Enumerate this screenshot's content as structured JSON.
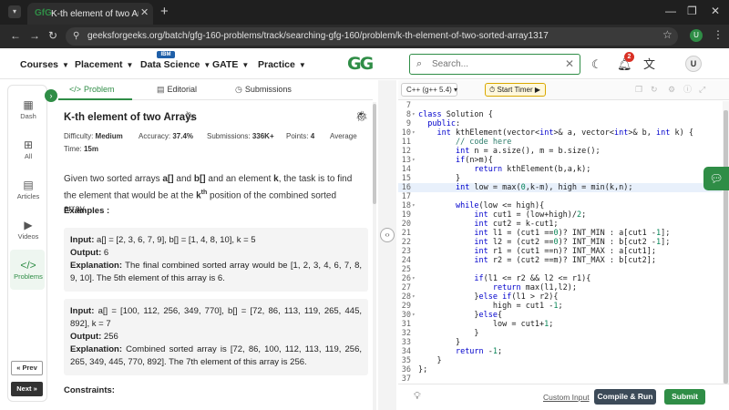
{
  "browser": {
    "tab_title": "K-th element of two Arrays | Pr",
    "favicon": "GfG",
    "url": "geeksforgeeks.org/batch/gfg-160-problems/track/searching-gfg-160/problem/k-th-element-of-two-sorted-array1317",
    "profile_initial": "U"
  },
  "header": {
    "nav": [
      {
        "label": "Courses"
      },
      {
        "label": "Placement"
      },
      {
        "label": "Data Science"
      },
      {
        "label": "GATE"
      },
      {
        "label": "Practice"
      }
    ],
    "ibm_badge": "IBM",
    "logo": "GG",
    "search_placeholder": "Search...",
    "notification_count": "2",
    "user_initial": "U"
  },
  "left_nav": {
    "items": [
      {
        "label": "Dash",
        "icon": "dashboard-icon"
      },
      {
        "label": "All",
        "icon": "grid-icon"
      },
      {
        "label": "Articles",
        "icon": "book-icon"
      },
      {
        "label": "Videos",
        "icon": "video-icon"
      },
      {
        "label": "Problems",
        "icon": "code-icon"
      }
    ],
    "prev": "« Prev",
    "next": "Next »"
  },
  "problem": {
    "tabs": [
      {
        "label": "Problem"
      },
      {
        "label": "Editorial"
      },
      {
        "label": "Submissions"
      }
    ],
    "title": "K-th element of two Arrays",
    "meta": {
      "difficulty_label": "Difficulty:",
      "difficulty": "Medium",
      "accuracy_label": "Accuracy:",
      "accuracy": "37.4%",
      "submissions_label": "Submissions:",
      "submissions": "336K+",
      "points_label": "Points:",
      "points": "4",
      "average": "Average",
      "time_label": "Time:",
      "time": "15m"
    },
    "description": {
      "p1": "Given two sorted arrays ",
      "a": "a[]",
      "p2": " and ",
      "b": "b[]",
      "p3": " and an element ",
      "k": "k",
      "p4": ", the task is to find the element that would be at the ",
      "kth": "k",
      "th": "th",
      "p5": " position of the combined sorted array."
    },
    "examples_heading": "Examples :",
    "examples": [
      {
        "input_label": "Input:",
        "input": " a[] = [2, 3, 6, 7, 9], b[] = [1, 4, 8, 10], k = 5",
        "output_label": "Output:",
        "output": " 6",
        "explanation_label": "Explanation:",
        "explanation": " The final combined sorted array would be [1, 2, 3, 4, 6, 7, 8, 9, 10]. The 5th element of this array is 6."
      },
      {
        "input_label": "Input:",
        "input": " a[] = [100, 112, 256, 349, 770], b[] = [72, 86, 113, 119, 265, 445, 892], k = 7",
        "output_label": "Output:",
        "output": " 256",
        "explanation_label": "Explanation:",
        "explanation": " Combined sorted array is [72, 86, 100, 112, 113, 119, 256, 265, 349, 445, 770, 892]. The 7th element of this array is 256."
      }
    ],
    "constraints_heading": "Constraints:"
  },
  "editor": {
    "language": "C++ (g++ 5.4)",
    "start_timer": "Start Timer",
    "lines": [
      {
        "n": "7",
        "fold": "",
        "html": ""
      },
      {
        "n": "8",
        "fold": "▾",
        "html": "<span class=\"kw\">class</span> Solution {"
      },
      {
        "n": "9",
        "fold": "",
        "html": "  <span class=\"kw\">public</span>:"
      },
      {
        "n": "10",
        "fold": "▾",
        "html": "    <span class=\"ty\">int</span> kthElement(vector&lt;<span class=\"ty\">int</span>&gt;&amp; a, vector&lt;<span class=\"ty\">int</span>&gt;&amp; b, <span class=\"ty\">int</span> k) {"
      },
      {
        "n": "11",
        "fold": "",
        "html": "        <span class=\"cm\">// code here</span>"
      },
      {
        "n": "12",
        "fold": "",
        "html": "        <span class=\"ty\">int</span> n = a.size(), m = b.size();"
      },
      {
        "n": "13",
        "fold": "▾",
        "html": "        <span class=\"kw\">if</span>(n&gt;m){"
      },
      {
        "n": "14",
        "fold": "",
        "html": "            <span class=\"kw\">return</span> kthElement(b,a,k);"
      },
      {
        "n": "15",
        "fold": "",
        "html": "        }"
      },
      {
        "n": "16",
        "fold": "",
        "html": "        <span class=\"ty\">int</span> low = max(<span class=\"num\">0</span>,k-m), high = min(k,n);",
        "hl": true
      },
      {
        "n": "17",
        "fold": "",
        "html": ""
      },
      {
        "n": "18",
        "fold": "▾",
        "html": "        <span class=\"kw\">while</span>(low &lt;= high){"
      },
      {
        "n": "19",
        "fold": "",
        "html": "            <span class=\"ty\">int</span> cut1 = (low+high)/<span class=\"num\">2</span>;"
      },
      {
        "n": "20",
        "fold": "",
        "html": "            <span class=\"ty\">int</span> cut2 = k-cut1;"
      },
      {
        "n": "21",
        "fold": "",
        "html": "            <span class=\"ty\">int</span> l1 = (cut1 ==<span class=\"num\">0</span>)? INT_MIN : a[cut1 -<span class=\"num\">1</span>];"
      },
      {
        "n": "22",
        "fold": "",
        "html": "            <span class=\"ty\">int</span> l2 = (cut2 ==<span class=\"num\">0</span>)? INT_MIN : b[cut2 -<span class=\"num\">1</span>];"
      },
      {
        "n": "23",
        "fold": "",
        "html": "            <span class=\"ty\">int</span> r1 = (cut1 ==n)? INT_MAX : a[cut1];"
      },
      {
        "n": "24",
        "fold": "",
        "html": "            <span class=\"ty\">int</span> r2 = (cut2 ==m)? INT_MAX : b[cut2];"
      },
      {
        "n": "25",
        "fold": "",
        "html": ""
      },
      {
        "n": "26",
        "fold": "▾",
        "html": "            <span class=\"kw\">if</span>(l1 &lt;= r2 &amp;&amp; l2 &lt;= r1){"
      },
      {
        "n": "27",
        "fold": "",
        "html": "                <span class=\"kw\">return</span> max(l1,l2);"
      },
      {
        "n": "28",
        "fold": "▾",
        "html": "            }<span class=\"kw\">else if</span>(l1 &gt; r2){"
      },
      {
        "n": "29",
        "fold": "",
        "html": "                high = cut1 -<span class=\"num\">1</span>;"
      },
      {
        "n": "30",
        "fold": "▾",
        "html": "            }<span class=\"kw\">else</span>{"
      },
      {
        "n": "31",
        "fold": "",
        "html": "                low = cut1+<span class=\"num\">1</span>;"
      },
      {
        "n": "32",
        "fold": "",
        "html": "            }"
      },
      {
        "n": "33",
        "fold": "",
        "html": "        }"
      },
      {
        "n": "34",
        "fold": "",
        "html": "        <span class=\"kw\">return</span> -<span class=\"num\">1</span>;"
      },
      {
        "n": "35",
        "fold": "",
        "html": "    }"
      },
      {
        "n": "36",
        "fold": "",
        "html": "};"
      },
      {
        "n": "37",
        "fold": "",
        "html": ""
      }
    ],
    "custom_input": "Custom Input",
    "compile_run": "Compile & Run",
    "submit": "Submit"
  },
  "colors": {
    "brand_green": "#2f8d46",
    "compile_bg": "#3c4a58",
    "notification_red": "#d93025"
  }
}
